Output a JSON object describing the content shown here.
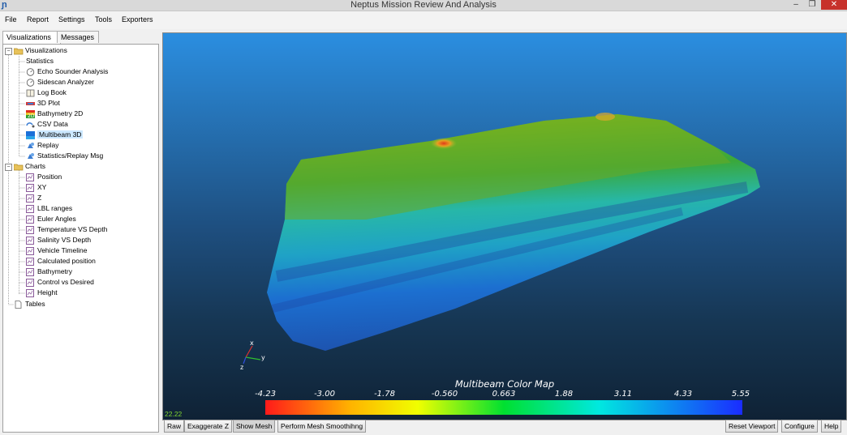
{
  "window": {
    "title": "Neptus Mission Review And Analysis",
    "app_icon": "neptus-logo-icon",
    "controls": {
      "minimize": "–",
      "maximize": "❐",
      "close": "✕"
    }
  },
  "menu": [
    "File",
    "Report",
    "Settings",
    "Tools",
    "Exporters"
  ],
  "left_tabs": [
    "Visualizations",
    "Messages"
  ],
  "tree": {
    "visualizations": {
      "label": "Visualizations",
      "items": [
        {
          "label": "Statistics",
          "icon": "none"
        },
        {
          "label": "Echo Sounder Analysis",
          "icon": "gauge-icon"
        },
        {
          "label": "Sidescan Analyzer",
          "icon": "gauge-icon"
        },
        {
          "label": "Log Book",
          "icon": "book-icon"
        },
        {
          "label": "3D Plot",
          "icon": "plot3d-icon"
        },
        {
          "label": "Bathymetry 2D",
          "icon": "bathymetry-2d-icon"
        },
        {
          "label": "CSV Data",
          "icon": "csv-icon"
        },
        {
          "label": "Multibeam 3D",
          "icon": "multibeam-icon"
        },
        {
          "label": "Replay",
          "icon": "replay-icon"
        },
        {
          "label": "Statistics/Replay Msg",
          "icon": "replay-icon"
        }
      ]
    },
    "charts": {
      "label": "Charts",
      "items": [
        "Position",
        "XY",
        "Z",
        "LBL ranges",
        "Euler Angles",
        "Temperature VS Depth",
        "Salinity VS Depth",
        "Vehicle Timeline",
        "Calculated position",
        "Bathymetry",
        "Control vs Desired",
        "Height"
      ]
    },
    "tables": {
      "label": "Tables"
    },
    "selected": "Multibeam 3D"
  },
  "viewport": {
    "axes": {
      "x": "x",
      "y": "y",
      "z": "z"
    },
    "colormap_title": "Multibeam Color Map",
    "colormap_ticks": [
      "-4.23",
      "-3.00",
      "-1.78",
      "-0.560",
      "0.663",
      "1.88",
      "3.11",
      "4.33",
      "5.55"
    ],
    "fps": "22.22"
  },
  "buttons": {
    "raw": "Raw",
    "exaggerate_z": "Exaggerate Z",
    "show_mesh": "Show Mesh",
    "mesh_smoothing": "Perform Mesh Smoothihng",
    "reset_viewport": "Reset Viewport",
    "configure": "Configure",
    "help": "Help"
  },
  "colors": {
    "sky_top": "#2b8ee0",
    "sky_bottom": "#0f2235",
    "selection": "#cce8ff",
    "close_button": "#c7312b"
  }
}
